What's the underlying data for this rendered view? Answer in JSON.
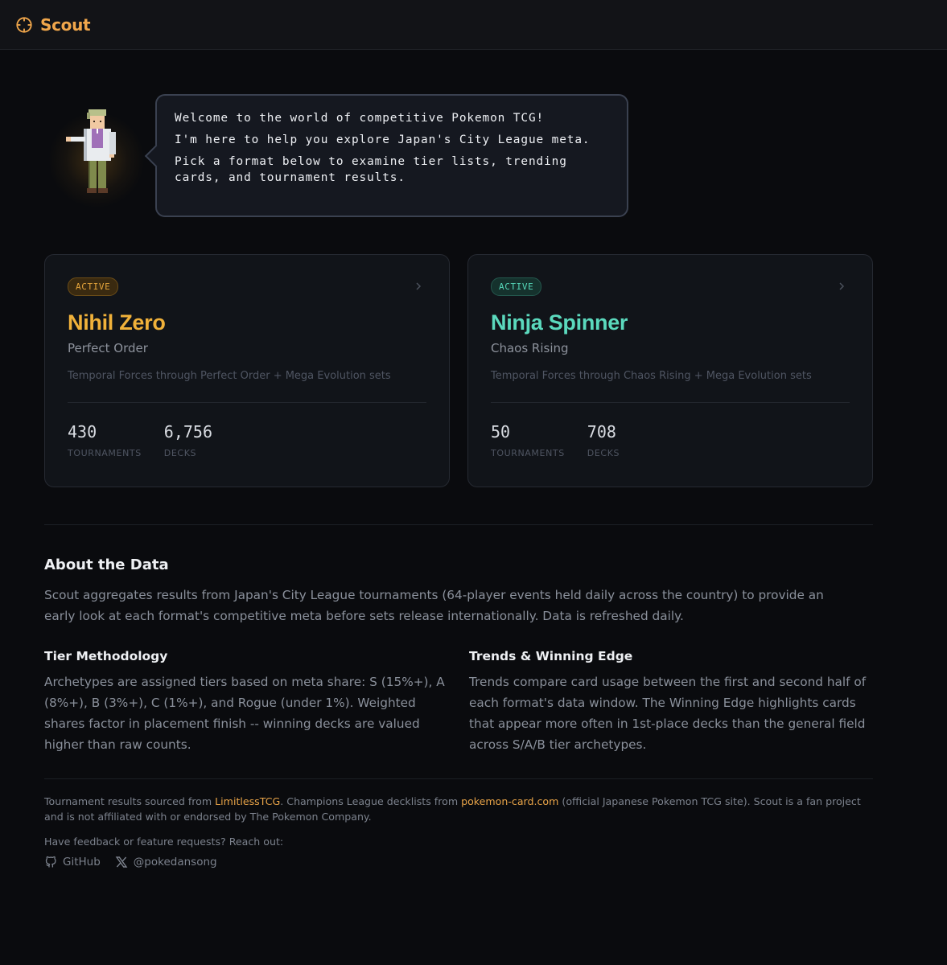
{
  "header": {
    "brand": "Scout",
    "accent": "#f0a64b",
    "brand_icon": "crosshair-icon"
  },
  "hero": {
    "sprite": "professor-character",
    "lines": [
      "Welcome to the world of competitive Pokemon TCG!",
      "I'm here to help you explore Japan's City League meta.",
      "Pick a format below to examine tier lists, trending cards, and tournament results."
    ]
  },
  "formats": [
    {
      "status": "ACTIVE",
      "name": "Nihil Zero",
      "set": "Perfect Order",
      "description": "Temporal Forces through Perfect Order + Mega Evolution sets",
      "tournaments_value": "430",
      "tournaments_label": "TOURNAMENTS",
      "decks_value": "6,756",
      "decks_label": "DECKS",
      "color": "#f0b13a"
    },
    {
      "status": "ACTIVE",
      "name": "Ninja Spinner",
      "set": "Chaos Rising",
      "description": "Temporal Forces through Chaos Rising + Mega Evolution sets",
      "tournaments_value": "50",
      "tournaments_label": "TOURNAMENTS",
      "decks_value": "708",
      "decks_label": "DECKS",
      "color": "#5bd9bd"
    }
  ],
  "about": {
    "title": "About the Data",
    "text": "Scout aggregates results from Japan's City League tournaments (64-player events held daily across the country) to provide an early look at each format's competitive meta before sets release internationally. Data is refreshed daily.",
    "tier_title": "Tier Methodology",
    "tier_text": "Archetypes are assigned tiers based on meta share: S (15%+), A (8%+), B (3%+), C (1%+), and Rogue (under 1%). Weighted shares factor in placement finish -- winning decks are valued higher than raw counts.",
    "trends_title": "Trends & Winning Edge",
    "trends_text": "Trends compare card usage between the first and second half of each format's data window. The Winning Edge highlights cards that appear more often in 1st-place decks than the general field across S/A/B tier archetypes."
  },
  "footer": {
    "p1": "Tournament results sourced from ",
    "link1": "LimitlessTCG",
    "p2": ". Champions League decklists from ",
    "link2": "pokemon-card.com",
    "p3": " (official Japanese Pokemon TCG site). Scout is a fan project and is not affiliated with or endorsed by The Pokemon Company.",
    "feedback": "Have feedback or feature requests? Reach out:",
    "github": "GitHub",
    "twitter": "@pokedansong"
  }
}
